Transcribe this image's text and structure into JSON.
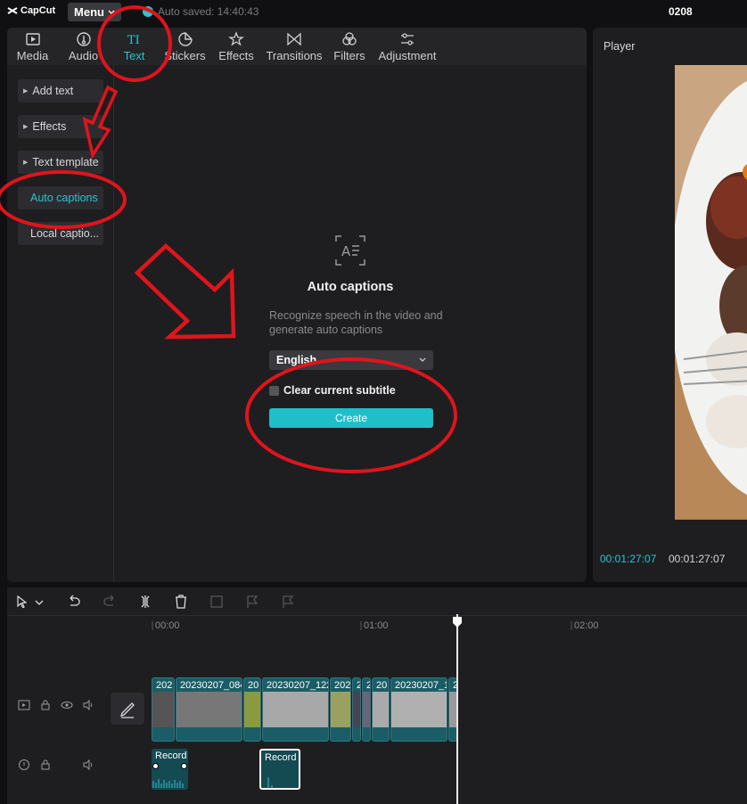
{
  "app": {
    "logo_text": "CapCut",
    "menu_label": "Menu",
    "autosave_text": "Auto saved: 14:40:43",
    "project_name": "0208"
  },
  "tabs": [
    {
      "label": "Media",
      "icon": "media-icon"
    },
    {
      "label": "Audio",
      "icon": "audio-icon"
    },
    {
      "label": "Text",
      "icon": "text-icon",
      "active": true
    },
    {
      "label": "Stickers",
      "icon": "stickers-icon"
    },
    {
      "label": "Effects",
      "icon": "effects-icon"
    },
    {
      "label": "Transitions",
      "icon": "transitions-icon"
    },
    {
      "label": "Filters",
      "icon": "filters-icon"
    },
    {
      "label": "Adjustment",
      "icon": "adjustment-icon"
    }
  ],
  "sidebar": {
    "items": [
      {
        "label": "Add text",
        "expandable": true
      },
      {
        "label": "Effects",
        "expandable": true
      },
      {
        "label": "Text template",
        "expandable": true
      },
      {
        "label": "Auto captions",
        "active": true
      },
      {
        "label": "Local captio..."
      }
    ]
  },
  "auto_captions": {
    "title": "Auto captions",
    "description": "Recognize speech in the video and generate auto captions",
    "language": "English",
    "clear_label": "Clear current subtitle",
    "create_label": "Create"
  },
  "player": {
    "title": "Player",
    "current_time": "00:01:27:07",
    "total_time": "00:01:27:07"
  },
  "timeline": {
    "ruler_labels": [
      "00:00",
      "01:00",
      "02:00"
    ],
    "video_clips": [
      {
        "label": "202"
      },
      {
        "label": "20230207_084"
      },
      {
        "label": "20"
      },
      {
        "label": "20230207_122"
      },
      {
        "label": "202"
      },
      {
        "label": "2"
      },
      {
        "label": "2"
      },
      {
        "label": "20"
      },
      {
        "label": "20230207_1"
      },
      {
        "label": "2"
      }
    ],
    "audio_clips": [
      {
        "label": "Record"
      },
      {
        "label": "Record"
      }
    ]
  },
  "colors": {
    "accent": "#2bc4d0",
    "panel": "#1e1e20",
    "annotation": "#e0141c"
  }
}
